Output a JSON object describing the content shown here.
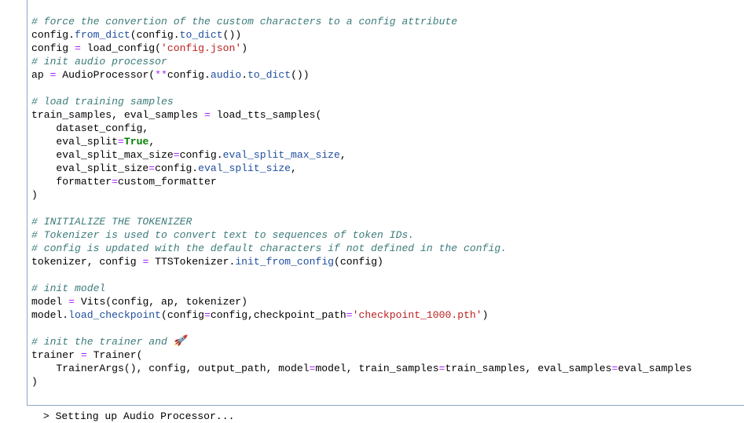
{
  "code_lines": [
    [
      {
        "t": "# force the convertion of the custom characters to a config attribute",
        "c": "c"
      }
    ],
    [
      {
        "t": "config."
      },
      {
        "t": "from_dict",
        "c": "a"
      },
      {
        "t": "(config."
      },
      {
        "t": "to_dict",
        "c": "a"
      },
      {
        "t": "())"
      }
    ],
    [
      {
        "t": "config "
      },
      {
        "t": "=",
        "c": "op"
      },
      {
        "t": " load_config("
      },
      {
        "t": "'config.json'",
        "c": "s"
      },
      {
        "t": ")"
      }
    ],
    [
      {
        "t": "# init audio processor",
        "c": "c"
      }
    ],
    [
      {
        "t": "ap "
      },
      {
        "t": "=",
        "c": "op"
      },
      {
        "t": " AudioProcessor("
      },
      {
        "t": "**",
        "c": "op"
      },
      {
        "t": "config."
      },
      {
        "t": "audio",
        "c": "a"
      },
      {
        "t": "."
      },
      {
        "t": "to_dict",
        "c": "a"
      },
      {
        "t": "())"
      }
    ],
    [],
    [
      {
        "t": "# load training samples",
        "c": "c"
      }
    ],
    [
      {
        "t": "train_samples, eval_samples "
      },
      {
        "t": "=",
        "c": "op"
      },
      {
        "t": " load_tts_samples("
      }
    ],
    [
      {
        "t": "    dataset_config,"
      }
    ],
    [
      {
        "t": "    eval_split"
      },
      {
        "t": "=",
        "c": "op"
      },
      {
        "t": "True",
        "c": "kw"
      },
      {
        "t": ","
      }
    ],
    [
      {
        "t": "    eval_split_max_size"
      },
      {
        "t": "=",
        "c": "op"
      },
      {
        "t": "config."
      },
      {
        "t": "eval_split_max_size",
        "c": "a"
      },
      {
        "t": ","
      }
    ],
    [
      {
        "t": "    eval_split_size"
      },
      {
        "t": "=",
        "c": "op"
      },
      {
        "t": "config."
      },
      {
        "t": "eval_split_size",
        "c": "a"
      },
      {
        "t": ","
      }
    ],
    [
      {
        "t": "    formatter"
      },
      {
        "t": "=",
        "c": "op"
      },
      {
        "t": "custom_formatter"
      }
    ],
    [
      {
        "t": ")"
      }
    ],
    [],
    [
      {
        "t": "# INITIALIZE THE TOKENIZER",
        "c": "c"
      }
    ],
    [
      {
        "t": "# Tokenizer is used to convert text to sequences of token IDs.",
        "c": "c"
      }
    ],
    [
      {
        "t": "# config is updated with the default characters if not defined in the config.",
        "c": "c"
      }
    ],
    [
      {
        "t": "tokenizer, config "
      },
      {
        "t": "=",
        "c": "op"
      },
      {
        "t": " TTSTokenizer."
      },
      {
        "t": "init_from_config",
        "c": "a"
      },
      {
        "t": "(config)"
      }
    ],
    [],
    [
      {
        "t": "# init model",
        "c": "c"
      }
    ],
    [
      {
        "t": "model "
      },
      {
        "t": "=",
        "c": "op"
      },
      {
        "t": " Vits(config, ap, tokenizer)"
      }
    ],
    [
      {
        "t": "model."
      },
      {
        "t": "load_checkpoint",
        "c": "a"
      },
      {
        "t": "(config"
      },
      {
        "t": "=",
        "c": "op"
      },
      {
        "t": "config,checkpoint_path"
      },
      {
        "t": "=",
        "c": "op"
      },
      {
        "t": "'checkpoint_1000.pth'",
        "c": "s"
      },
      {
        "t": ")"
      }
    ],
    [],
    [
      {
        "t": "# init the trainer and ",
        "c": "c"
      },
      {
        "t": "🚀",
        "c": "c rocket"
      }
    ],
    [
      {
        "t": "trainer "
      },
      {
        "t": "=",
        "c": "op"
      },
      {
        "t": " Trainer("
      }
    ],
    [
      {
        "t": "    TrainerArgs(), config, output_path, model"
      },
      {
        "t": "=",
        "c": "op"
      },
      {
        "t": "model, train_samples"
      },
      {
        "t": "=",
        "c": "op"
      },
      {
        "t": "train_samples, eval_samples"
      },
      {
        "t": "=",
        "c": "op"
      },
      {
        "t": "eval_samples"
      }
    ],
    [
      {
        "t": ")"
      }
    ]
  ],
  "output": {
    "text": " > Setting up Audio Processor..."
  },
  "colors": {
    "comment": "#3d7b7b",
    "operator": "#aa22ff",
    "keyword": "#008000",
    "string": "#ba2121",
    "attribute": "#1f4e9e",
    "cell_border": "#8aa6c8"
  }
}
